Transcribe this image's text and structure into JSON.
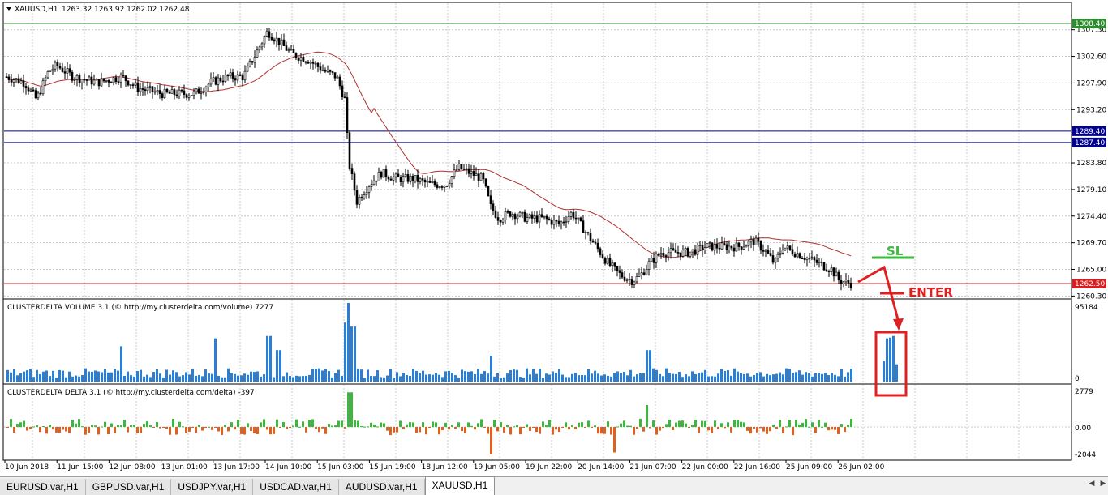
{
  "main_chart": {
    "title": "XAUUSD,H1",
    "ohlc": "1263.32 1263.92 1262.02 1262.48",
    "price_labels": [
      "1307.30",
      "1302.60",
      "1297.90",
      "1293.20",
      "1283.80",
      "1279.10",
      "1274.40",
      "1269.70",
      "1265.00",
      "1260.30"
    ],
    "levels": [
      {
        "label": "1308.40",
        "color": "#2e8b2e"
      },
      {
        "label": "1289.40",
        "color": "#00008b"
      },
      {
        "label": "1287.40",
        "color": "#00008b"
      },
      {
        "label": "1262.50",
        "color": "#d42020"
      }
    ],
    "annotations": {
      "sl": "SL",
      "enter": "ENTER"
    }
  },
  "volume_panel": {
    "title": "CLUSTERDELTA VOLUME 3.1 (© http://my.clusterdelta.com/volume) 7277",
    "max_label": "95184",
    "min_label": "0"
  },
  "delta_panel": {
    "title": "CLUSTERDELTA DELTA 3.1 (© http://my.clusterdelta.com/delta) -397",
    "labels": [
      "2779",
      "0.00",
      "-2044"
    ]
  },
  "time_axis": [
    "10 Jun 2018",
    "11 Jun 15:00",
    "12 Jun 08:00",
    "13 Jun 01:00",
    "13 Jun 17:00",
    "14 Jun 10:00",
    "15 Jun 03:00",
    "15 Jun 19:00",
    "18 Jun 12:00",
    "19 Jun 05:00",
    "19 Jun 22:00",
    "20 Jun 14:00",
    "21 Jun 07:00",
    "22 Jun 00:00",
    "22 Jun 16:00",
    "25 Jun 09:00",
    "26 Jun 02:00"
  ],
  "tabs": [
    "EURUSD.var,H1",
    "GBPUSD.var,H1",
    "USDJPY.var,H1",
    "USDCAD.var,H1",
    "AUDUSD.var,H1",
    "XAUUSD,H1"
  ],
  "active_tab": "XAUUSD,H1",
  "colors": {
    "volume_bar": "#2a7fd4",
    "delta_positive": "#3cb83c",
    "delta_negative": "#e06020",
    "moving_average": "#b03030",
    "annotation": "#e02020",
    "sl_color": "#3cb83c"
  },
  "icons": {
    "chart_menu": "triangle-down-icon",
    "tab_left": "arrow-left-icon",
    "tab_right": "arrow-right-icon"
  }
}
